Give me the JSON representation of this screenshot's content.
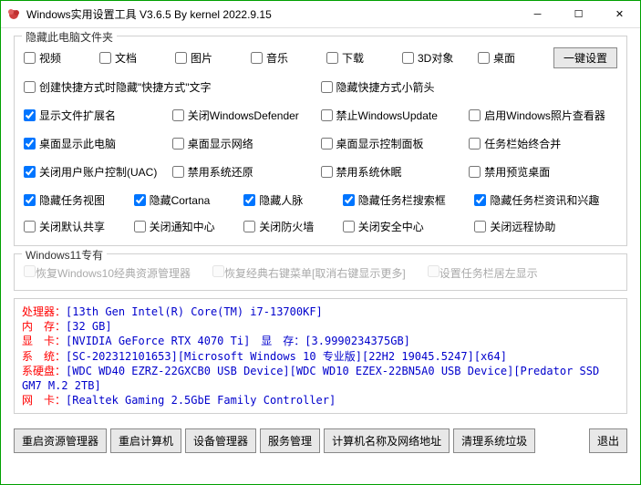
{
  "window": {
    "title": "Windows实用设置工具 V3.6.5 By kernel 2022.9.15"
  },
  "groups": {
    "hideFolders": {
      "title": "隐藏此电脑文件夹",
      "items": [
        {
          "label": "视频",
          "checked": false
        },
        {
          "label": "文档",
          "checked": false
        },
        {
          "label": "图片",
          "checked": false
        },
        {
          "label": "音乐",
          "checked": false
        },
        {
          "label": "下载",
          "checked": false
        },
        {
          "label": "3D对象",
          "checked": false
        },
        {
          "label": "桌面",
          "checked": false
        }
      ],
      "oneKey": "一键设置"
    },
    "settings": {
      "createShortcut": {
        "label": "创建快捷方式时隐藏\"快捷方式\"文字",
        "checked": false
      },
      "hideArrow": {
        "label": "隐藏快捷方式小箭头",
        "checked": false
      },
      "showExt": {
        "label": "显示文件扩展名",
        "checked": true
      },
      "closeDefender": {
        "label": "关闭WindowsDefender",
        "checked": false
      },
      "disableUpdate": {
        "label": "禁止WindowsUpdate",
        "checked": false
      },
      "enablePhoto": {
        "label": "启用Windows照片查看器",
        "checked": false
      },
      "showThisPC": {
        "label": "桌面显示此电脑",
        "checked": true
      },
      "showNetwork": {
        "label": "桌面显示网络",
        "checked": false
      },
      "showControl": {
        "label": "桌面显示控制面板",
        "checked": false
      },
      "noCombine": {
        "label": "任务栏始终合并",
        "checked": false
      },
      "closeUAC": {
        "label": "关闭用户账户控制(UAC)",
        "checked": true
      },
      "disableRestore": {
        "label": "禁用系统还原",
        "checked": false
      },
      "disableSleep": {
        "label": "禁用系统休眠",
        "checked": false
      },
      "disablePreview": {
        "label": "禁用预览桌面",
        "checked": false
      },
      "hideTaskView": {
        "label": "隐藏任务视图",
        "checked": true
      },
      "hideCortana": {
        "label": "隐藏Cortana",
        "checked": true
      },
      "hidePeople": {
        "label": "隐藏人脉",
        "checked": true
      },
      "hideSearch": {
        "label": "隐藏任务栏搜索框",
        "checked": true
      },
      "hideNews": {
        "label": "隐藏任务栏资讯和兴趣",
        "checked": true
      },
      "closeShare": {
        "label": "关闭默认共享",
        "checked": false
      },
      "closeNotify": {
        "label": "关闭通知中心",
        "checked": false
      },
      "closeFirewall": {
        "label": "关闭防火墙",
        "checked": false
      },
      "closeSecurity": {
        "label": "关闭安全中心",
        "checked": false
      },
      "closeRemote": {
        "label": "关闭远程协助",
        "checked": false
      }
    },
    "win11": {
      "title": "Windows11专有",
      "restoreExplorer": {
        "label": "恢复Windows10经典资源管理器"
      },
      "restoreMenu": {
        "label": "恢复经典右键菜单[取消右键显示更多]"
      },
      "taskbarLeft": {
        "label": "设置任务栏居左显示"
      }
    }
  },
  "sysinfo": {
    "cpu": {
      "lbl": "处理器：",
      "val": "[13th Gen Intel(R) Core(TM) i7-13700KF]"
    },
    "mem": {
      "lbl": "内　存：",
      "val": "[32 GB]"
    },
    "gpu": {
      "lbl": "显　卡：",
      "val": "[NVIDIA GeForce RTX 4070 Ti]　显　存：[3.9990234375GB]"
    },
    "sys": {
      "lbl": "系　统：",
      "val": "[SC-202312101653][Microsoft Windows 10 专业版][22H2 19045.5247][x64]"
    },
    "hdd": {
      "lbl": "系硬盘：",
      "val": "[WDC WD40 EZRZ-22GXCB0 USB Device][WDC WD10 EZEX-22BN5A0 USB Device][Predator SSD GM7 M.2 2TB]"
    },
    "net": {
      "lbl": "网　卡：",
      "val": "[Realtek Gaming 2.5GbE Family Controller]"
    }
  },
  "buttons": {
    "restartExplorer": "重启资源管理器",
    "restartPC": "重启计算机",
    "deviceMgr": "设备管理器",
    "serviceMgr": "服务管理",
    "pcName": "计算机名称及网络地址",
    "cleanTrash": "清理系统垃圾",
    "exit": "退出"
  }
}
